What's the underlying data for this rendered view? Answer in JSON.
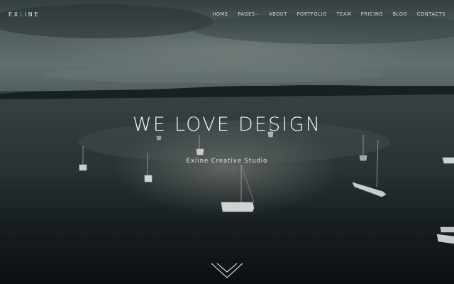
{
  "logo": {
    "part1": "EX",
    "part2": "L",
    "part3": "INE"
  },
  "nav": {
    "items": [
      {
        "label": "HOME"
      },
      {
        "label": "PAGES",
        "has_dropdown": true
      },
      {
        "label": "ABOUT"
      },
      {
        "label": "PORTFOLIO"
      },
      {
        "label": "TEAM"
      },
      {
        "label": "PRICING"
      },
      {
        "label": "BLOG"
      },
      {
        "label": "CONTACTS"
      }
    ],
    "caret": "⌄"
  },
  "hero": {
    "title": "WE LOVE DESIGN",
    "subtitle": "Exline Creative Studio"
  },
  "icons": {
    "scroll": "chevron-down-icon"
  },
  "colors": {
    "accent": "#39b8c9",
    "text": "#ffffff"
  }
}
